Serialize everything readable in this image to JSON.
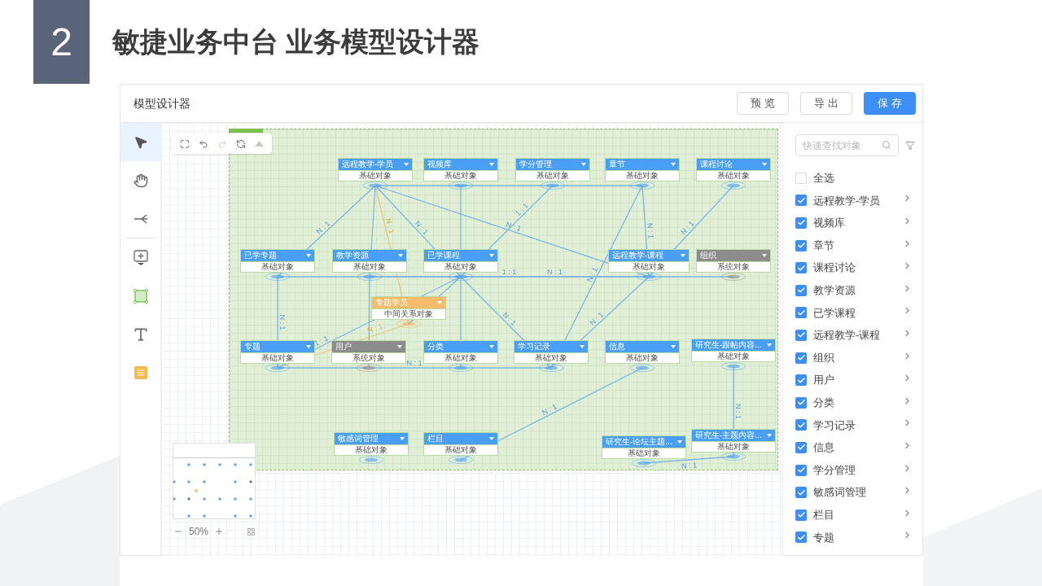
{
  "slide": {
    "number": "2",
    "title": "敏捷业务中台 业务模型设计器"
  },
  "app": {
    "title": "模型设计器",
    "buttons": [
      {
        "label": "预览",
        "primary": false
      },
      {
        "label": "导出",
        "primary": false
      },
      {
        "label": "保存",
        "primary": true
      }
    ]
  },
  "nodes": [
    {
      "name": "远程教学-学员",
      "type": "基础对象",
      "kind": "basic"
    },
    {
      "name": "视频库",
      "type": "基础对象",
      "kind": "basic"
    },
    {
      "name": "学分管理",
      "type": "基础对象",
      "kind": "basic"
    },
    {
      "name": "章节",
      "type": "基础对象",
      "kind": "basic"
    },
    {
      "name": "课程讨论",
      "type": "基础对象",
      "kind": "basic"
    },
    {
      "name": "已学专题",
      "type": "基础对象",
      "kind": "basic"
    },
    {
      "name": "教学资源",
      "type": "基础对象",
      "kind": "basic"
    },
    {
      "name": "已学课程",
      "type": "基础对象",
      "kind": "basic"
    },
    {
      "name": "远程教学-课程",
      "type": "基础对象",
      "kind": "basic"
    },
    {
      "name": "组织",
      "type": "系统对象",
      "kind": "system"
    },
    {
      "name": "专题学员",
      "type": "中间关系对象",
      "kind": "relation"
    },
    {
      "name": "专题",
      "type": "基础对象",
      "kind": "basic"
    },
    {
      "name": "用户",
      "type": "系统对象",
      "kind": "system"
    },
    {
      "name": "分类",
      "type": "基础对象",
      "kind": "basic"
    },
    {
      "name": "学习记录",
      "type": "基础对象",
      "kind": "basic"
    },
    {
      "name": "信息",
      "type": "基础对象",
      "kind": "basic"
    },
    {
      "name": "研究生-跟帖内容...",
      "type": "基础对象",
      "kind": "basic"
    },
    {
      "name": "敏感词管理",
      "type": "基础对象",
      "kind": "basic"
    },
    {
      "name": "栏目",
      "type": "基础对象",
      "kind": "basic"
    },
    {
      "name": "研究生-论坛主题...",
      "type": "基础对象",
      "kind": "basic"
    },
    {
      "name": "研究生-主题内容...",
      "type": "基础对象",
      "kind": "basic"
    }
  ],
  "edges": [
    {
      "label": "N : 1",
      "kind": "basic"
    },
    {
      "kind": "basic"
    },
    {
      "label": "N : 1",
      "kind": "relation"
    },
    {
      "label": "N : 1",
      "kind": "basic"
    },
    {
      "kind": "basic"
    },
    {
      "label": "N : 1",
      "kind": "basic"
    },
    {
      "kind": "basic"
    },
    {
      "label": "1 : 1",
      "kind": "basic"
    },
    {
      "label": "N : 1",
      "kind": "basic"
    },
    {
      "label": "N : 1",
      "kind": "basic"
    },
    {
      "label": "N : 1",
      "kind": "basic"
    },
    {
      "kind": "basic"
    },
    {
      "kind": "basic"
    },
    {
      "label": "N : 1",
      "kind": "basic"
    },
    {
      "label": "1 : 1",
      "kind": "basic"
    },
    {
      "label": "N : 1",
      "kind": "basic"
    },
    {
      "kind": "basic"
    },
    {
      "label": "1 : 1",
      "kind": "basic"
    },
    {
      "kind": "basic"
    },
    {
      "kind": "basic"
    },
    {
      "label": "N : 1",
      "kind": "basic"
    },
    {
      "label": "N : 1",
      "kind": "basic"
    },
    {
      "label": "N : 1",
      "kind": "relation"
    },
    {
      "label": "N : 1",
      "kind": "basic"
    },
    {
      "label": "N : 1",
      "kind": "basic"
    },
    {
      "label": "N : 1",
      "kind": "basic"
    },
    {
      "label": "N : 1",
      "kind": "basic"
    }
  ],
  "zoom": "50%",
  "panel": {
    "search": {
      "placeholder": "快速查找对象"
    },
    "items": [
      {
        "label": "全选",
        "checked": false,
        "kind": "all"
      },
      {
        "label": "远程教学-学员",
        "checked": true,
        "kind": "object"
      },
      {
        "label": "视频库",
        "checked": true,
        "kind": "object"
      },
      {
        "label": "章节",
        "checked": true,
        "kind": "object"
      },
      {
        "label": "课程讨论",
        "checked": true,
        "kind": "object"
      },
      {
        "label": "教学资源",
        "checked": true,
        "kind": "object"
      },
      {
        "label": "已学课程",
        "checked": true,
        "kind": "object"
      },
      {
        "label": "远程教学-课程",
        "checked": true,
        "kind": "object"
      },
      {
        "label": "组织",
        "checked": true,
        "kind": "object"
      },
      {
        "label": "用户",
        "checked": true,
        "kind": "object"
      },
      {
        "label": "分类",
        "checked": true,
        "kind": "object"
      },
      {
        "label": "学习记录",
        "checked": true,
        "kind": "object"
      },
      {
        "label": "信息",
        "checked": true,
        "kind": "object"
      },
      {
        "label": "学分管理",
        "checked": true,
        "kind": "object"
      },
      {
        "label": "敏感词管理",
        "checked": true,
        "kind": "object"
      },
      {
        "label": "栏目",
        "checked": true,
        "kind": "object"
      },
      {
        "label": "专题",
        "checked": true,
        "kind": "object"
      }
    ]
  }
}
